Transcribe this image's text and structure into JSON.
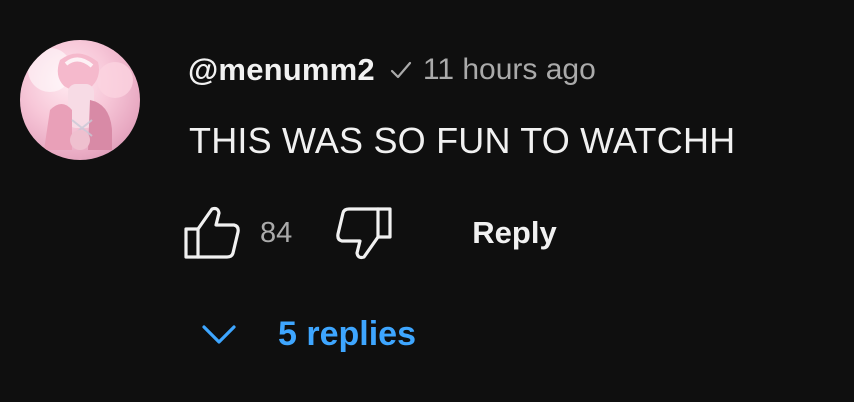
{
  "comment": {
    "author": {
      "handle": "@menumm2",
      "avatar_icon": "avatar-image"
    },
    "timestamp": "11 hours ago",
    "text": "THIS WAS SO FUN TO WATCHH",
    "actions": {
      "like_icon": "thumbs-up-icon",
      "like_count": "84",
      "dislike_icon": "thumbs-down-icon",
      "reply_label": "Reply"
    },
    "replies": {
      "icon": "chevron-down-icon",
      "label": "5 replies"
    }
  },
  "colors": {
    "background": "#0f0f0f",
    "primary_text": "#f1f1f1",
    "secondary_text": "#aaaaaa",
    "link_blue": "#3ea6ff"
  }
}
